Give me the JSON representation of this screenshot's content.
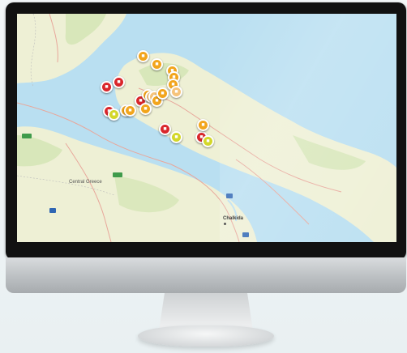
{
  "map": {
    "labels": [
      {
        "text": "Central Greece",
        "kind": "region"
      },
      {
        "text": "Chalkida",
        "kind": "city"
      }
    ],
    "colors": {
      "sea": "#b9dff1",
      "land": "#eef0d5",
      "green_land": "#cfe3ae",
      "marker_red": "#d9262b",
      "marker_orange": "#f2a51c",
      "marker_yellow": "#d3d72a",
      "marker_light": "#f6c37a"
    },
    "markers": [
      {
        "status": "orange",
        "icon": "bus-icon"
      },
      {
        "status": "orange",
        "icon": "bus-icon"
      },
      {
        "status": "orange",
        "icon": "bus-icon"
      },
      {
        "status": "orange",
        "icon": "bus-icon"
      },
      {
        "status": "orange",
        "icon": "bus-icon"
      },
      {
        "status": "red",
        "icon": "bus-icon"
      },
      {
        "status": "red",
        "icon": "bus-icon"
      },
      {
        "status": "red",
        "icon": "bus-icon"
      },
      {
        "status": "orange",
        "icon": "bus-icon"
      },
      {
        "status": "light",
        "icon": "bus-icon"
      },
      {
        "status": "light",
        "icon": "bus-icon"
      },
      {
        "status": "orange",
        "icon": "bus-icon"
      },
      {
        "status": "orange",
        "icon": "bus-icon"
      },
      {
        "status": "red",
        "icon": "bus-icon"
      },
      {
        "status": "yellow",
        "icon": "bus-icon"
      },
      {
        "status": "orange",
        "icon": "bus-icon"
      },
      {
        "status": "orange",
        "icon": "bus-icon"
      },
      {
        "status": "orange",
        "icon": "bus-icon"
      },
      {
        "status": "red",
        "icon": "bus-icon"
      },
      {
        "status": "yellow",
        "icon": "bus-icon"
      },
      {
        "status": "orange",
        "icon": "bus-icon"
      },
      {
        "status": "yellow",
        "icon": "bus-icon"
      },
      {
        "status": "red",
        "icon": "bus-icon"
      },
      {
        "status": "light",
        "icon": "bus-icon"
      }
    ]
  }
}
